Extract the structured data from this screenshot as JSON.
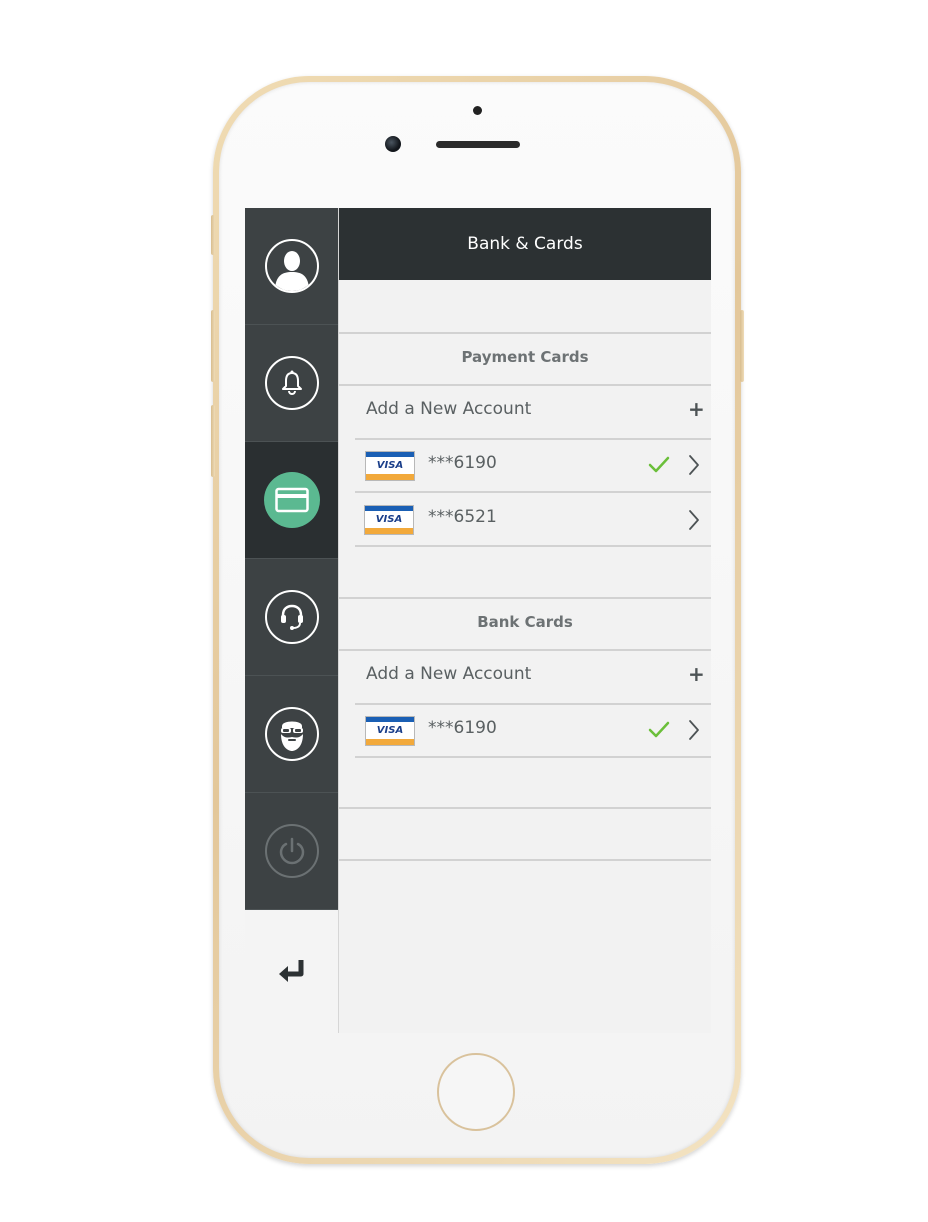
{
  "app": {
    "title": "Bank & Cards"
  },
  "sidebar": {
    "items": [
      {
        "icon": "user-icon",
        "active": false
      },
      {
        "icon": "bell-icon",
        "active": false
      },
      {
        "icon": "credit-card-icon",
        "active": true
      },
      {
        "icon": "headset-icon",
        "active": false
      },
      {
        "icon": "bearded-man-icon",
        "active": false
      },
      {
        "icon": "power-icon",
        "active": false,
        "disabled": true
      }
    ],
    "back_icon": "return-arrow-icon"
  },
  "payment_cards": {
    "heading": "Payment Cards",
    "add_label": "Add a New Account",
    "add_icon": "+",
    "cards": [
      {
        "brand": "VISA",
        "number": "***6190",
        "selected": true
      },
      {
        "brand": "VISA",
        "number": "***6521",
        "selected": false
      }
    ]
  },
  "bank_cards": {
    "heading": "Bank Cards",
    "add_label": "Add a New Account",
    "add_icon": "+",
    "cards": [
      {
        "brand": "VISA",
        "number": "***6190",
        "selected": true
      }
    ]
  },
  "colors": {
    "sidebar_bg": "#3d4244",
    "sidebar_active_bg": "#2a2f31",
    "title_bar_bg": "#2c3133",
    "accent_green": "#5bb991",
    "check_green": "#6bbf3a",
    "visa_blue": "#1a5fb4",
    "visa_orange": "#f2a93b",
    "phone_gold": "#e3c79a"
  }
}
